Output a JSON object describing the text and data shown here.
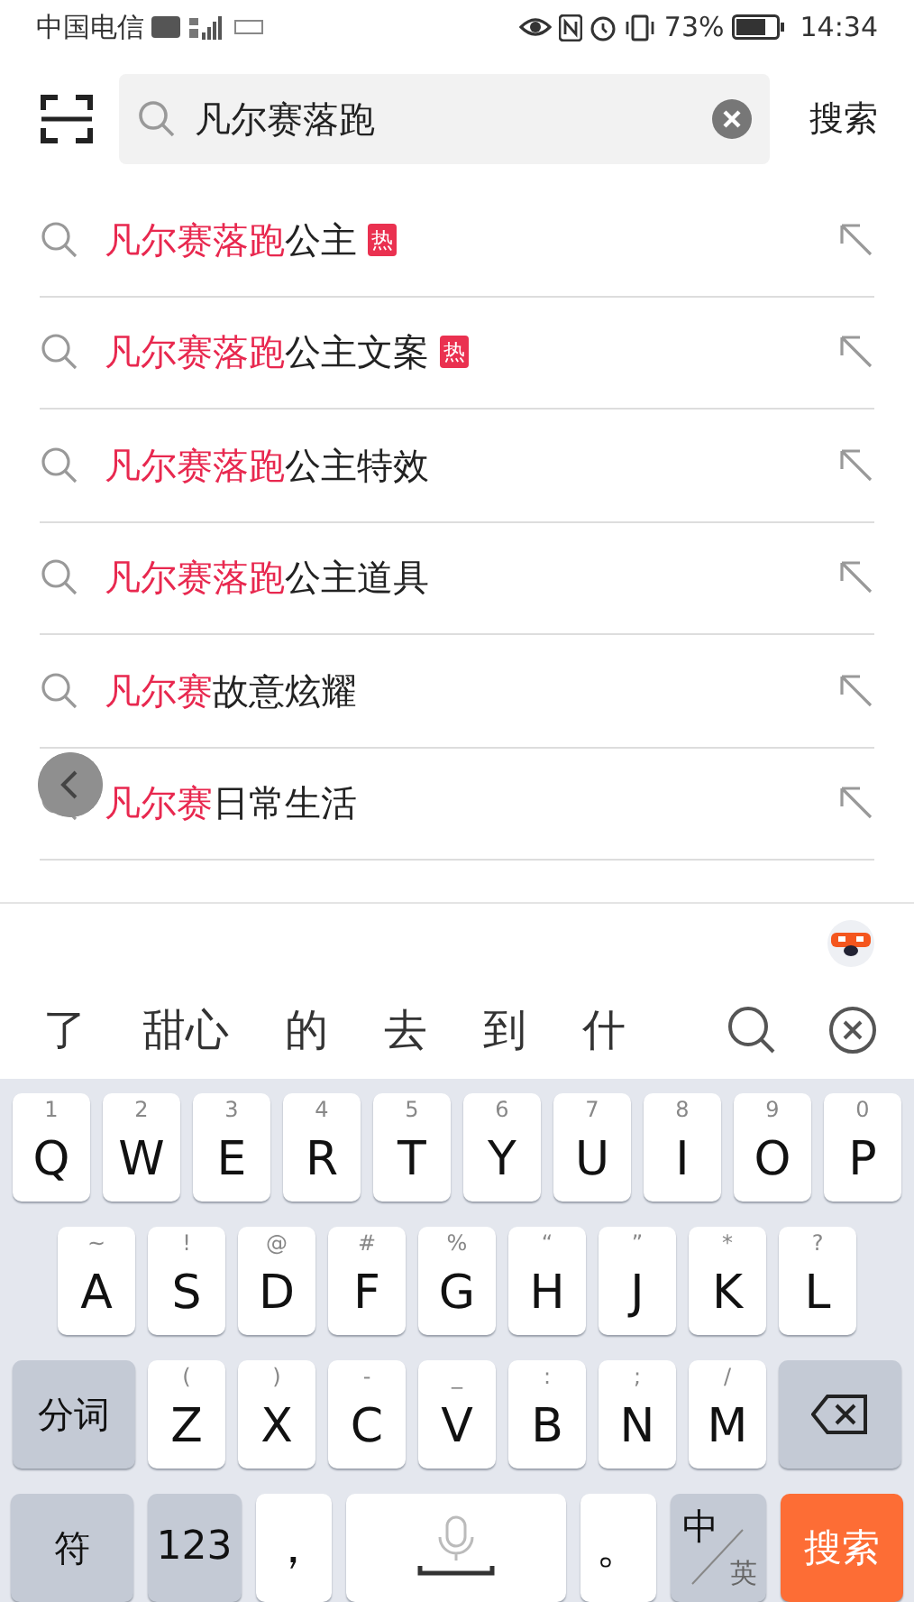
{
  "status_bar": {
    "carrier": "中国电信",
    "battery": "73%",
    "time": "14:34"
  },
  "search": {
    "value": "凡尔赛落跑",
    "button": "搜索"
  },
  "suggestions": [
    {
      "highlight": "凡尔赛落跑",
      "rest": "公主",
      "badge": "热"
    },
    {
      "highlight": "凡尔赛落跑",
      "rest": "公主文案",
      "badge": "热"
    },
    {
      "highlight": "凡尔赛落跑",
      "rest": "公主特效"
    },
    {
      "highlight": "凡尔赛落跑",
      "rest": "公主道具"
    },
    {
      "highlight": "凡尔赛",
      "rest": "故意炫耀"
    },
    {
      "highlight": "凡尔赛",
      "rest": "日常生活"
    }
  ],
  "candidates": [
    "了",
    "甜心",
    "的",
    "去",
    "到",
    "什"
  ],
  "keyboard": [
    [
      {
        "kind": "letter",
        "label": "Q",
        "hint": "1"
      },
      {
        "kind": "letter",
        "label": "W",
        "hint": "2"
      },
      {
        "kind": "letter",
        "label": "E",
        "hint": "3"
      },
      {
        "kind": "letter",
        "label": "R",
        "hint": "4"
      },
      {
        "kind": "letter",
        "label": "T",
        "hint": "5"
      },
      {
        "kind": "letter",
        "label": "Y",
        "hint": "6"
      },
      {
        "kind": "letter",
        "label": "U",
        "hint": "7"
      },
      {
        "kind": "letter",
        "label": "I",
        "hint": "8"
      },
      {
        "kind": "letter",
        "label": "O",
        "hint": "9"
      },
      {
        "kind": "letter",
        "label": "P",
        "hint": "0"
      }
    ],
    [
      {
        "kind": "letter",
        "label": "A",
        "hint": "~"
      },
      {
        "kind": "letter",
        "label": "S",
        "hint": "!"
      },
      {
        "kind": "letter",
        "label": "D",
        "hint": "@"
      },
      {
        "kind": "letter",
        "label": "F",
        "hint": "#"
      },
      {
        "kind": "letter",
        "label": "G",
        "hint": "%"
      },
      {
        "kind": "letter",
        "label": "H",
        "hint": "“"
      },
      {
        "kind": "letter",
        "label": "J",
        "hint": "”"
      },
      {
        "kind": "letter",
        "label": "K",
        "hint": "*"
      },
      {
        "kind": "letter",
        "label": "L",
        "hint": "?"
      }
    ],
    [
      {
        "kind": "func",
        "label": "分词"
      },
      {
        "kind": "letter",
        "label": "Z",
        "hint": "("
      },
      {
        "kind": "letter",
        "label": "X",
        "hint": ")"
      },
      {
        "kind": "letter",
        "label": "C",
        "hint": "-"
      },
      {
        "kind": "letter",
        "label": "V",
        "hint": "_"
      },
      {
        "kind": "letter",
        "label": "B",
        "hint": ":"
      },
      {
        "kind": "letter",
        "label": "N",
        "hint": ";"
      },
      {
        "kind": "letter",
        "label": "M",
        "hint": "/"
      },
      {
        "kind": "backspace"
      }
    ],
    [
      {
        "kind": "func",
        "label": "符"
      },
      {
        "kind": "num",
        "label": "123"
      },
      {
        "kind": "punct",
        "label": "，"
      },
      {
        "kind": "space"
      },
      {
        "kind": "punct",
        "label": "。"
      },
      {
        "kind": "toggle",
        "label": "中",
        "sub": "英"
      },
      {
        "kind": "action",
        "label": "搜索"
      }
    ]
  ]
}
